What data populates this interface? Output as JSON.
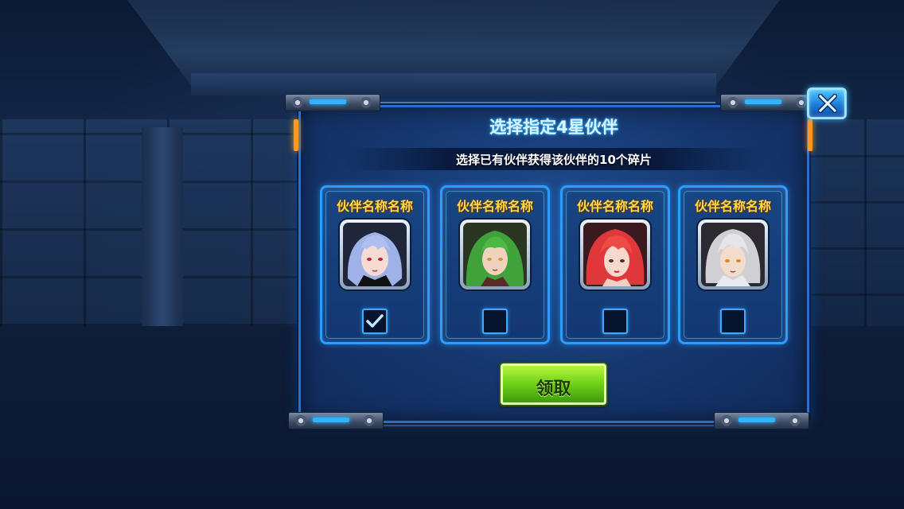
{
  "dialog": {
    "title": "选择指定4星伙伴",
    "subtitle": "选择已有伙伴获得该伙伴的10个碎片"
  },
  "partners": [
    {
      "name": "伙伴名称名称",
      "selected": true,
      "portrait": "blue-haired-girl-portrait"
    },
    {
      "name": "伙伴名称名称",
      "selected": false,
      "portrait": "green-haired-girl-portrait"
    },
    {
      "name": "伙伴名称名称",
      "selected": false,
      "portrait": "red-haired-girl-portrait"
    },
    {
      "name": "伙伴名称名称",
      "selected": false,
      "portrait": "silver-haired-girl-portrait"
    }
  ],
  "claim_button": {
    "label": "领取"
  },
  "icons": {
    "close": "close-icon",
    "check": "checkmark-icon"
  },
  "colors": {
    "panel": "#16376e",
    "frame": "#2e9cff",
    "name_text": "#ffd94a",
    "claim_green": "#6ed018",
    "close_blue": "#1876d6"
  }
}
